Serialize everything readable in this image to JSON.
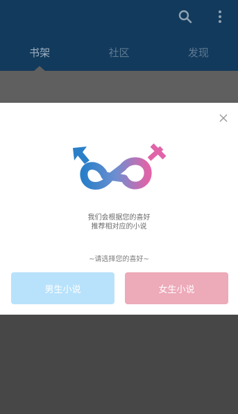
{
  "appbar": {
    "search_icon": "search-icon",
    "more_icon": "more-vert-icon"
  },
  "tabs": [
    {
      "label": "书架"
    },
    {
      "label": "社区"
    },
    {
      "label": "发现"
    }
  ],
  "dialog": {
    "tagline_line1": "我们会根据您的喜好",
    "tagline_line2": "推荐相对应的小说",
    "choose_label": "~请选择您的喜好~",
    "male_button": "男生小说",
    "female_button": "女生小说",
    "male_color": "#b8e2fb",
    "female_color": "#edaab9"
  }
}
